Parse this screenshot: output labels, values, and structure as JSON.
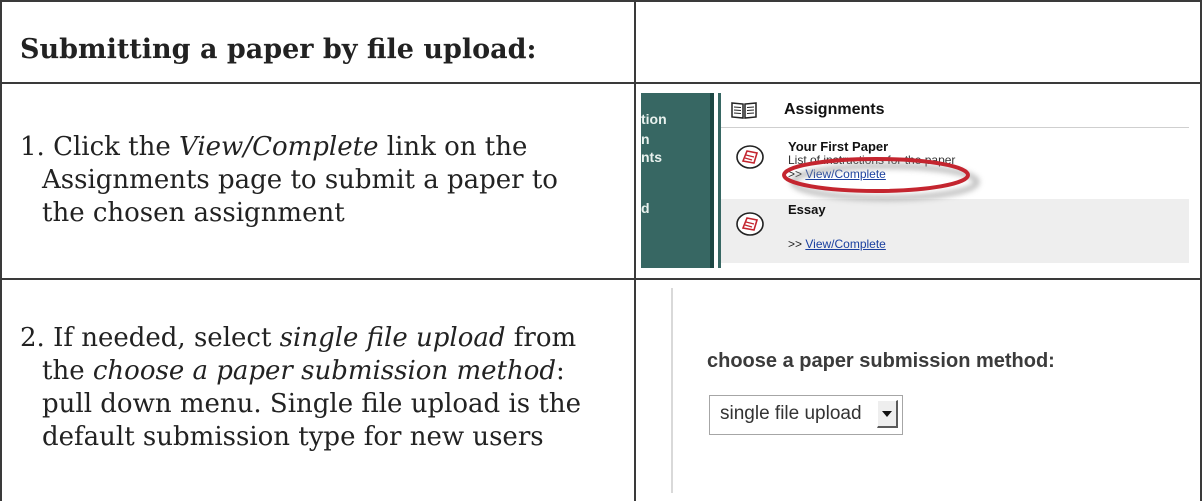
{
  "header": {
    "title": "Submitting a paper by file upload:"
  },
  "steps": [
    {
      "num": "1.",
      "lines": [
        [
          "Click the ",
          "View/Complete",
          " link on the"
        ],
        [
          "Assignments page to submit a paper to"
        ],
        [
          "the chosen assignment"
        ]
      ]
    },
    {
      "num": "2.",
      "lines": [
        [
          "If needed, select ",
          "single file upload",
          " from"
        ],
        [
          "the ",
          "choose a paper submission method",
          ":"
        ],
        [
          "pull down menu. Single file upload is the"
        ],
        [
          "default submission type for new users"
        ]
      ]
    }
  ],
  "shot1": {
    "nav_fragments": [
      "tion",
      "n",
      "nts",
      "d"
    ],
    "section_title": "Assignments",
    "items": [
      {
        "title": "Your First Paper",
        "description": "List of instructions for the paper",
        "link_prefix": ">>",
        "link_text": "View/Complete"
      },
      {
        "title": "Essay",
        "description": "",
        "link_prefix": ">>",
        "link_text": "View/Complete"
      }
    ],
    "colors": {
      "nav": "#376763",
      "highlight": "#c4252f"
    }
  },
  "shot2": {
    "label": "choose a paper submission method:",
    "select_value": "single file upload"
  }
}
